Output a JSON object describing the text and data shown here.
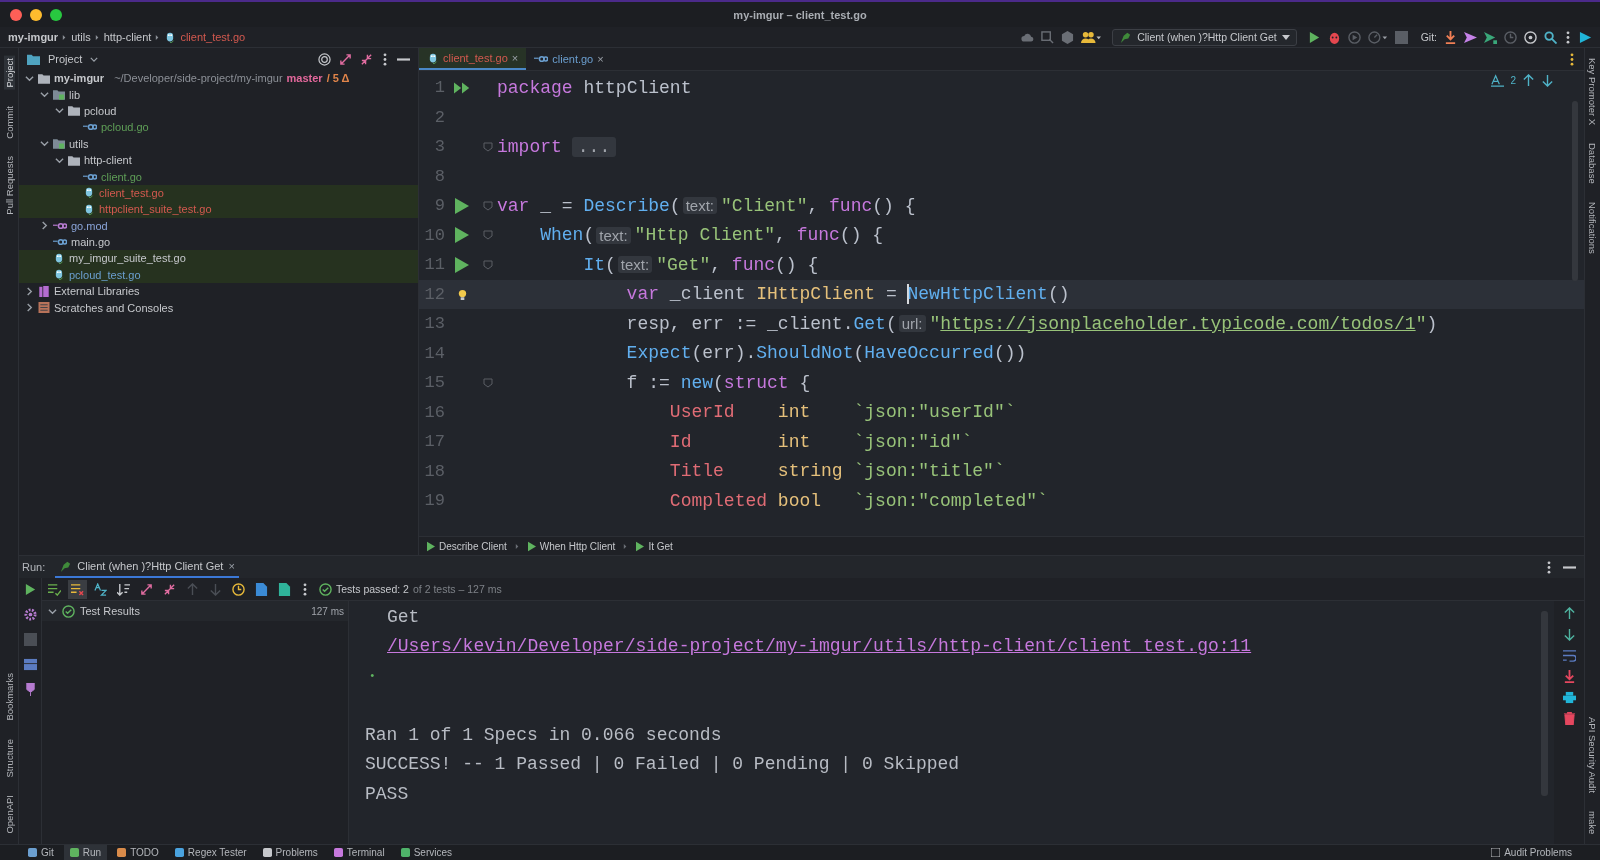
{
  "window": {
    "title": "my-imgur – client_test.go"
  },
  "breadcrumbs": [
    {
      "text": "my-imgur",
      "kind": "project"
    },
    {
      "text": "utils",
      "kind": "folder"
    },
    {
      "text": "http-client",
      "kind": "folder"
    },
    {
      "text": "client_test.go",
      "kind": "file"
    }
  ],
  "toolbar": {
    "run_config": "Client (when )?Http Client Get",
    "git_label": "Git:"
  },
  "left_tool_tabs": [
    {
      "label": "Project",
      "selected": true
    },
    {
      "label": "Commit",
      "selected": false
    },
    {
      "label": "Pull Requests",
      "selected": false
    }
  ],
  "left_bottom_tabs": [
    {
      "label": "Bookmarks"
    },
    {
      "label": "Structure"
    },
    {
      "label": "OpenAPI"
    }
  ],
  "right_tool_tabs": [
    {
      "label": "Key Promoter X"
    },
    {
      "label": "Database"
    },
    {
      "label": "Notifications"
    }
  ],
  "right_bottom_tabs": [
    {
      "label": "API Security Audit"
    },
    {
      "label": "make"
    }
  ],
  "project_panel": {
    "title": "Project",
    "tree": [
      {
        "label": "my-imgur",
        "kind": "project",
        "path": "~/Developer/side-project/my-imgur",
        "branch": "master",
        "changes": "/ 5 Δ",
        "highlighted": false,
        "expanded": true,
        "children": [
          {
            "label": "lib",
            "kind": "module",
            "highlighted": false,
            "expanded": true,
            "children": [
              {
                "label": "pcloud",
                "kind": "folder",
                "highlighted": false,
                "expanded": true,
                "children": [
                  {
                    "label": "pcloud.go",
                    "kind": "go",
                    "color": "#5f9f57",
                    "highlighted": false
                  }
                ]
              }
            ]
          },
          {
            "label": "utils",
            "kind": "module",
            "highlighted": false,
            "expanded": true,
            "children": [
              {
                "label": "http-client",
                "kind": "folder",
                "highlighted": false,
                "expanded": true,
                "children": [
                  {
                    "label": "client.go",
                    "kind": "go",
                    "color": "#5f9f57",
                    "highlighted": false
                  },
                  {
                    "label": "client_test.go",
                    "kind": "go-test",
                    "color": "#d3594f",
                    "highlighted": true
                  },
                  {
                    "label": "httpclient_suite_test.go",
                    "kind": "go-test",
                    "color": "#d3594f",
                    "highlighted": true
                  }
                ]
              }
            ]
          },
          {
            "label": "go.mod",
            "kind": "gomod",
            "color": "#8aa4d8",
            "highlighted": false,
            "expanded": false
          },
          {
            "label": "main.go",
            "kind": "go",
            "highlighted": false
          },
          {
            "label": "my_imgur_suite_test.go",
            "kind": "go-test",
            "highlighted": true
          },
          {
            "label": "pcloud_test.go",
            "kind": "go-test",
            "color": "#6b9fd0",
            "highlighted": true
          }
        ]
      },
      {
        "label": "External Libraries",
        "kind": "library",
        "highlighted": false,
        "expanded": false
      },
      {
        "label": "Scratches and Consoles",
        "kind": "scratches",
        "highlighted": false,
        "expanded": false
      }
    ]
  },
  "editor": {
    "tabs": [
      {
        "label": "client_test.go",
        "close": "×",
        "selected": true,
        "color": "#d3594f"
      },
      {
        "label": "client.go",
        "close": "×",
        "selected": false,
        "color": "#6b9fd0"
      }
    ],
    "inspection_count": "2",
    "lines": [
      {
        "number": "1",
        "kind": "run-all",
        "fold": false,
        "tokens": [
          {
            "text": "package",
            "kind": "kw"
          },
          {
            "text": " httpClient",
            "kind": "plain"
          }
        ]
      },
      {
        "number": "2",
        "kind": "plain",
        "fold": false
      },
      {
        "number": "3",
        "kind": "plain",
        "fold": true,
        "tokens": [
          {
            "text": "import",
            "kind": "kw"
          },
          {
            "text": "...",
            "kind": "folded"
          }
        ]
      },
      {
        "number": "8",
        "kind": "plain",
        "fold": false
      },
      {
        "number": "9",
        "kind": "run",
        "fold": true,
        "tokens": [
          {
            "text": "var",
            "kind": "kw"
          },
          {
            "text": " _ = ",
            "kind": "plain"
          },
          {
            "text": "Describe",
            "kind": "fn"
          },
          {
            "text": "(",
            "kind": "plain"
          },
          {
            "text": "text:",
            "kind": "hint"
          },
          {
            "text": "\"Client\"",
            "kind": "str"
          },
          {
            "text": ", ",
            "kind": "plain"
          },
          {
            "text": "func",
            "kind": "kw"
          },
          {
            "text": "() {",
            "kind": "plain"
          }
        ]
      },
      {
        "number": "10",
        "kind": "run",
        "fold": true,
        "tokens": [
          {
            "text": "    When",
            "kind": "fn"
          },
          {
            "text": "(",
            "kind": "plain"
          },
          {
            "text": "text:",
            "kind": "hint"
          },
          {
            "text": "\"Http Client\"",
            "kind": "str"
          },
          {
            "text": ", ",
            "kind": "plain"
          },
          {
            "text": "func",
            "kind": "kw"
          },
          {
            "text": "() {",
            "kind": "plain"
          }
        ]
      },
      {
        "number": "11",
        "kind": "run",
        "fold": true,
        "tokens": [
          {
            "text": "        It",
            "kind": "fn"
          },
          {
            "text": "(",
            "kind": "plain"
          },
          {
            "text": "text:",
            "kind": "hint"
          },
          {
            "text": "\"Get\"",
            "kind": "str"
          },
          {
            "text": ", ",
            "kind": "plain"
          },
          {
            "text": "func",
            "kind": "kw"
          },
          {
            "text": "() {",
            "kind": "plain"
          }
        ]
      },
      {
        "number": "12",
        "kind": "bulb",
        "fold": false,
        "current": true,
        "tokens": [
          {
            "text": "            var",
            "kind": "kw"
          },
          {
            "text": " _client ",
            "kind": "plain"
          },
          {
            "text": "IHttpClient",
            "kind": "type"
          },
          {
            "text": " = ",
            "kind": "plain"
          },
          {
            "text": "NewHttpClient",
            "kind": "fn",
            "caret": true
          },
          {
            "text": "()",
            "kind": "plain"
          }
        ]
      },
      {
        "number": "13",
        "kind": "plain",
        "fold": false,
        "tokens": [
          {
            "text": "            resp, err := _client.",
            "kind": "plain"
          },
          {
            "text": "Get",
            "kind": "fn"
          },
          {
            "text": "(",
            "kind": "plain"
          },
          {
            "text": "url:",
            "kind": "hint"
          },
          {
            "text": "\"",
            "kind": "str"
          },
          {
            "text": "https://jsonplaceholder.typicode.com/todos/1",
            "kind": "link"
          },
          {
            "text": "\"",
            "kind": "str"
          },
          {
            "text": ")",
            "kind": "plain"
          }
        ]
      },
      {
        "number": "14",
        "kind": "plain",
        "fold": false,
        "tokens": [
          {
            "text": "            Expect",
            "kind": "fn"
          },
          {
            "text": "(err).",
            "kind": "plain"
          },
          {
            "text": "ShouldNot",
            "kind": "fn"
          },
          {
            "text": "(",
            "kind": "plain"
          },
          {
            "text": "HaveOccurred",
            "kind": "fn"
          },
          {
            "text": "())",
            "kind": "plain"
          }
        ]
      },
      {
        "number": "15",
        "kind": "plain",
        "fold": true,
        "tokens": [
          {
            "text": "            f := ",
            "kind": "plain"
          },
          {
            "text": "new",
            "kind": "fn"
          },
          {
            "text": "(",
            "kind": "plain"
          },
          {
            "text": "struct",
            "kind": "kw"
          },
          {
            "text": " {",
            "kind": "plain"
          }
        ]
      },
      {
        "number": "16",
        "kind": "plain",
        "fold": false,
        "tokens": [
          {
            "text": "                UserId",
            "kind": "field"
          },
          {
            "text": "    int",
            "kind": "type"
          },
          {
            "text": "    `json:\"userId\"`",
            "kind": "str"
          }
        ]
      },
      {
        "number": "17",
        "kind": "plain",
        "fold": false,
        "tokens": [
          {
            "text": "                Id",
            "kind": "field"
          },
          {
            "text": "        int",
            "kind": "type"
          },
          {
            "text": "    `json:\"id\"`",
            "kind": "str"
          }
        ]
      },
      {
        "number": "18",
        "kind": "plain",
        "fold": false,
        "tokens": [
          {
            "text": "                Title",
            "kind": "field"
          },
          {
            "text": "     string",
            "kind": "type"
          },
          {
            "text": " `json:\"title\"`",
            "kind": "str"
          }
        ]
      },
      {
        "number": "19",
        "kind": "plain",
        "fold": false,
        "tokens": [
          {
            "text": "                Completed",
            "kind": "field"
          },
          {
            "text": " bool",
            "kind": "type"
          },
          {
            "text": "   `json:\"completed\"`",
            "kind": "str"
          }
        ]
      }
    ],
    "breadcrumbs": [
      "Describe Client",
      "When Http Client",
      "It Get"
    ]
  },
  "run_panel": {
    "label": "Run:",
    "tab": {
      "label": "Client (when )?Http Client Get",
      "close": "×",
      "selected": true
    },
    "status": "Tests passed: 2",
    "status_detail": "of 2 tests – 127 ms",
    "results": {
      "label": "Test Results",
      "time": "127 ms",
      "passed": true,
      "expanded": true
    },
    "console": [
      {
        "text": "Get",
        "kind": "indented"
      },
      {
        "text": "/Users/kevin/Developer/side-project/my-imgur/utils/http-client/client_test.go:11",
        "kind": "link"
      },
      {
        "text": "•",
        "kind": "bullet"
      },
      {
        "kind": "gap"
      },
      {
        "text": "Ran 1 of 1 Specs in 0.066 seconds",
        "kind": "plain"
      },
      {
        "text": "SUCCESS! -- 1 Passed | 0 Failed | 0 Pending | 0 Skipped",
        "kind": "plain"
      },
      {
        "text": "PASS",
        "kind": "plain"
      }
    ]
  },
  "status_bar": {
    "tools": [
      {
        "label": "Git",
        "selected": false
      },
      {
        "label": "Run",
        "selected": true
      },
      {
        "label": "TODO",
        "selected": false
      },
      {
        "label": "Regex Tester",
        "selected": false
      },
      {
        "label": "Problems",
        "selected": false
      },
      {
        "label": "Terminal",
        "selected": false
      },
      {
        "label": "Services",
        "selected": false
      }
    ],
    "right": "Audit Problems"
  }
}
